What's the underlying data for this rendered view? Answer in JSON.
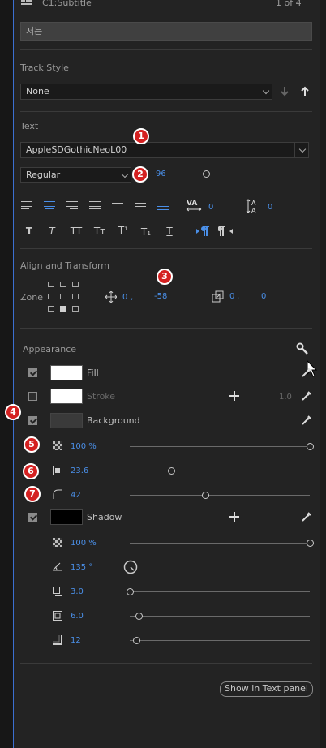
{
  "header": {
    "clip_name": "C1:Subtitle",
    "counter": "1 of 4",
    "caption_text": "저는"
  },
  "track_style": {
    "label": "Track Style",
    "value": "None"
  },
  "text": {
    "label": "Text",
    "font": "AppleSDGothicNeoL00",
    "weight": "Regular",
    "size": "96",
    "tracking": "0",
    "leading": "0",
    "paragraph_order_icons": [
      "ltr-icon",
      "rtl-icon"
    ]
  },
  "align_transform": {
    "label": "Align and Transform",
    "zone_label": "Zone",
    "pos_x": "0",
    "pos_sep": ",",
    "pos_y": "-58",
    "size_x": "0",
    "size_sep": ",",
    "size_y": "0"
  },
  "appearance": {
    "label": "Appearance",
    "fill": {
      "label": "Fill",
      "checked": true,
      "color": "#ffffff"
    },
    "stroke": {
      "label": "Stroke",
      "checked": false,
      "color": "#ffffff",
      "width": "1.0"
    },
    "background": {
      "label": "Background",
      "checked": true,
      "color": "#3a3a3a",
      "opacity": "100 %",
      "size": "23.6",
      "corner": "42",
      "opacity_frac": 1.0,
      "size_frac": 0.23,
      "corner_frac": 0.42
    },
    "shadow": {
      "label": "Shadow",
      "checked": true,
      "color": "#000000",
      "opacity": "100 %",
      "angle": "135 °",
      "distance": "3.0",
      "size": "6.0",
      "blur": "12",
      "opacity_frac": 1.0,
      "distance_frac": 0.0,
      "size_frac": 0.05,
      "blur_frac": 0.04
    }
  },
  "footer": {
    "show_button": "Show in Text panel"
  },
  "markers": [
    "1",
    "2",
    "3",
    "4",
    "5",
    "6",
    "7"
  ],
  "colors": {
    "accent": "#4a8fe8",
    "marker": "#d42121"
  }
}
